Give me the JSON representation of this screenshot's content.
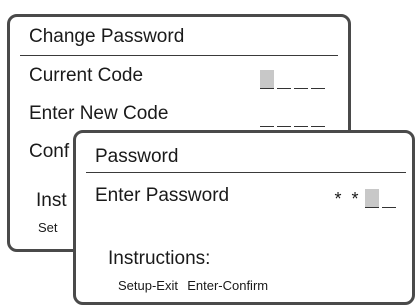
{
  "back_dialog": {
    "title": "Change Password",
    "current_code_label": "Current Code",
    "enter_new_code_label": "Enter New Code",
    "confirm_label_partial": "Conf",
    "instructions_partial": "Inst",
    "setup_partial": "Set"
  },
  "front_dialog": {
    "title": "Password",
    "enter_password_label": "Enter Password",
    "star": "*",
    "instructions_label": "Instructions:",
    "hint": "Setup-Exit  Enter-Confirm"
  }
}
